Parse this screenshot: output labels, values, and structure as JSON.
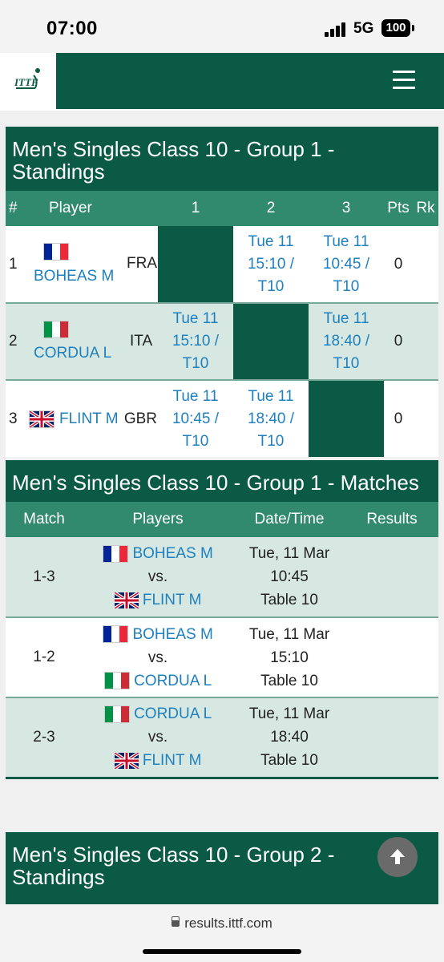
{
  "status": {
    "time": "07:00",
    "network": "5G",
    "battery": "100"
  },
  "browser": {
    "url": "results.ittf.com"
  },
  "standings1": {
    "title": "Men's Singles Class 10 - Group 1 - Standings",
    "headers": [
      "#",
      "Player",
      "1",
      "2",
      "3",
      "Pts",
      "Rk"
    ],
    "rows": [
      {
        "rank": "1",
        "name": "BOHEAS M",
        "country": "FRA",
        "pts": "0",
        "c1": "",
        "c2": "Tue 11 15:10 / T10",
        "c3": "Tue 11 10:45 / T10"
      },
      {
        "rank": "2",
        "name": "CORDUA L",
        "country": "ITA",
        "pts": "0",
        "c1": "Tue 11 15:10 / T10",
        "c2": "",
        "c3": "Tue 11 18:40 / T10"
      },
      {
        "rank": "3",
        "name": "FLINT M",
        "country": "GBR",
        "pts": "0",
        "c1": "Tue 11 10:45 / T10",
        "c2": "Tue 11 18:40 / T10",
        "c3": ""
      }
    ]
  },
  "matches1": {
    "title": "Men's Singles Class 10 - Group 1 - Matches",
    "headers": [
      "Match",
      "Players",
      "Date/Time",
      "Results"
    ],
    "rows": [
      {
        "match": "1-3",
        "p1": "BOHEAS M",
        "vs": "vs.",
        "p2": "FLINT M",
        "date": "Tue, 11 Mar",
        "time": "10:45",
        "table": "Table 10"
      },
      {
        "match": "1-2",
        "p1": "BOHEAS M",
        "vs": "vs.",
        "p2": "CORDUA L",
        "date": "Tue, 11 Mar",
        "time": "15:10",
        "table": "Table 10"
      },
      {
        "match": "2-3",
        "p1": "CORDUA L",
        "vs": "vs.",
        "p2": "FLINT M",
        "date": "Tue, 11 Mar",
        "time": "18:40",
        "table": "Table 10"
      }
    ]
  },
  "standings2": {
    "title": "Men's Singles Class 10 - Group 2 - Standings"
  },
  "logo": {
    "text": "ITTF"
  },
  "colors": {
    "primary": "#0b5a45",
    "header_row": "#328a6e",
    "tint_row": "#d7e8e2",
    "link": "#1f80bf"
  },
  "icons": {
    "menu": "hamburger-menu-icon",
    "scroll_top": "arrow-up-icon",
    "lock": "lock-icon"
  }
}
